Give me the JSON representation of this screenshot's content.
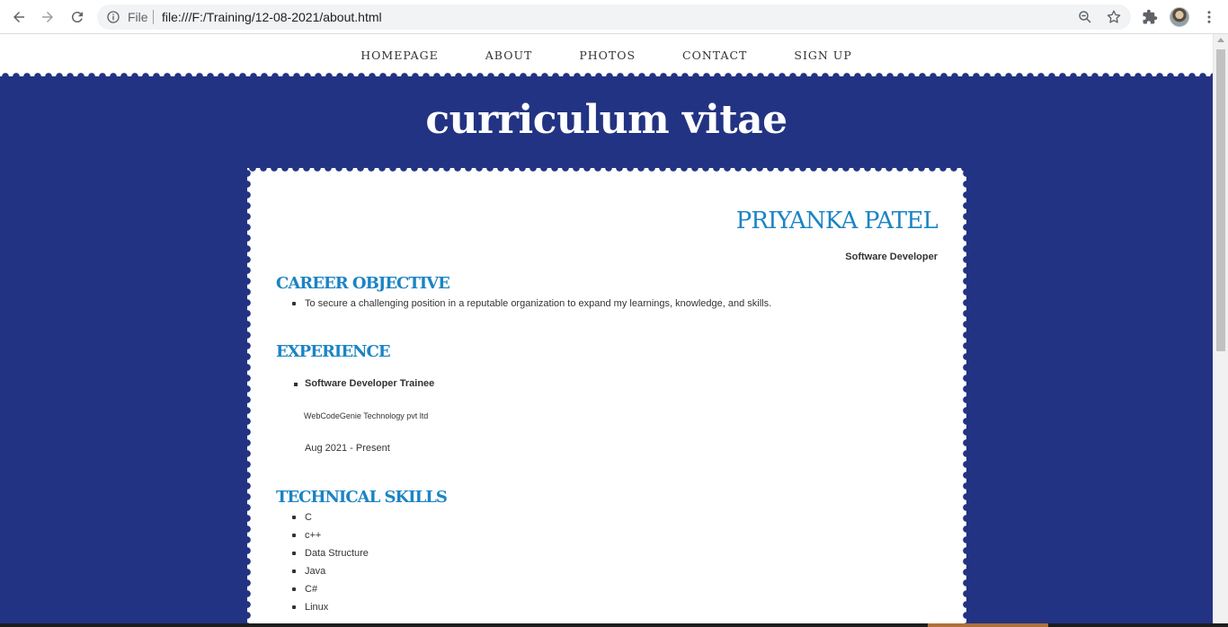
{
  "browser": {
    "file_label": "File",
    "url": "file:///F:/Training/12-08-2021/about.html"
  },
  "nav": {
    "items": [
      "HOMEPAGE",
      "ABOUT",
      "PHOTOS",
      "CONTACT",
      "SIGN UP"
    ]
  },
  "hero": {
    "title": "curriculum vitae"
  },
  "resume": {
    "name": "PRIYANKA PATEL",
    "role": "Software Developer",
    "career_heading": "CAREER OBJECTIVE",
    "career_text": "To secure a challenging position in a reputable organization to expand my learnings, knowledge, and skills.",
    "experience_heading": "EXPERIENCE",
    "experience": {
      "title": "Software Developer Trainee",
      "company": "WebCodeGenie Technology pvt ltd",
      "dates": "Aug 2021 - Present"
    },
    "skills_heading": "TECHNICAL SKILLS",
    "skills": [
      "C",
      "c++",
      "Data Structure",
      "Java",
      "C#",
      "Linux"
    ]
  },
  "colors": {
    "banner": "#233383",
    "accent": "#1b84c4"
  }
}
